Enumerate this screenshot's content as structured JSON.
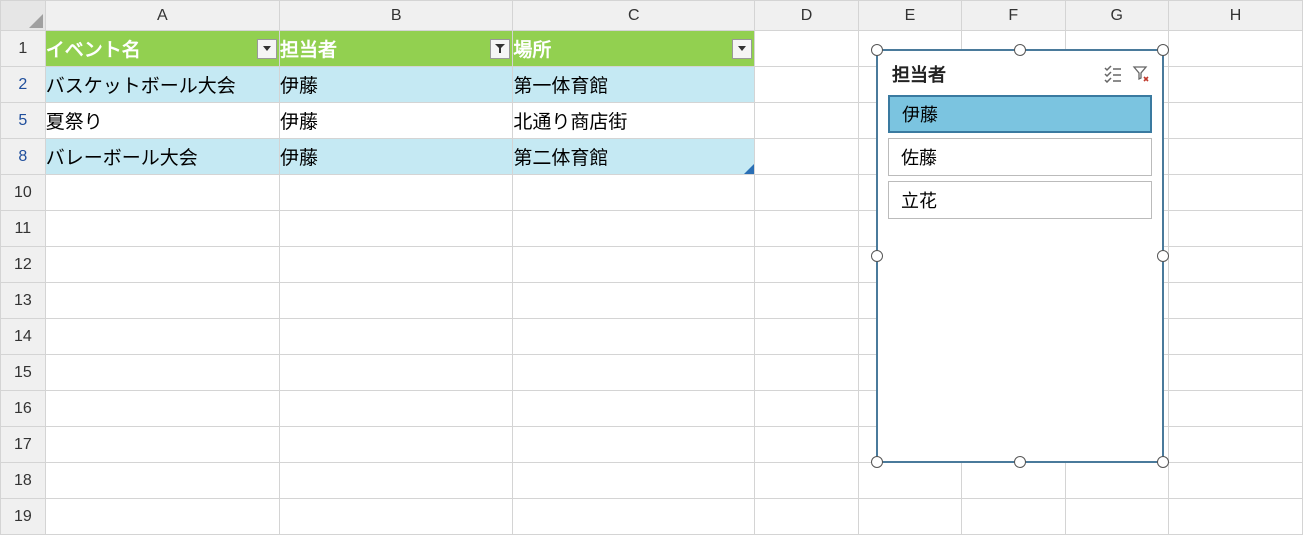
{
  "columns": [
    "A",
    "B",
    "C",
    "D",
    "E",
    "F",
    "G",
    "H"
  ],
  "row_numbers": [
    "1",
    "2",
    "5",
    "8",
    "10",
    "11",
    "12",
    "13",
    "14",
    "15",
    "16",
    "17",
    "18",
    "19"
  ],
  "table": {
    "headers": {
      "event": "イベント名",
      "person": "担当者",
      "place": "場所"
    },
    "rows": [
      {
        "event": "バスケットボール大会",
        "person": "伊藤",
        "place": "第一体育館"
      },
      {
        "event": "夏祭り",
        "person": "伊藤",
        "place": "北通り商店街"
      },
      {
        "event": "バレーボール大会",
        "person": "伊藤",
        "place": "第二体育館"
      }
    ]
  },
  "slicer": {
    "title": "担当者",
    "items": [
      {
        "label": "伊藤",
        "selected": true
      },
      {
        "label": "佐藤",
        "selected": false
      },
      {
        "label": "立花",
        "selected": false
      }
    ]
  }
}
